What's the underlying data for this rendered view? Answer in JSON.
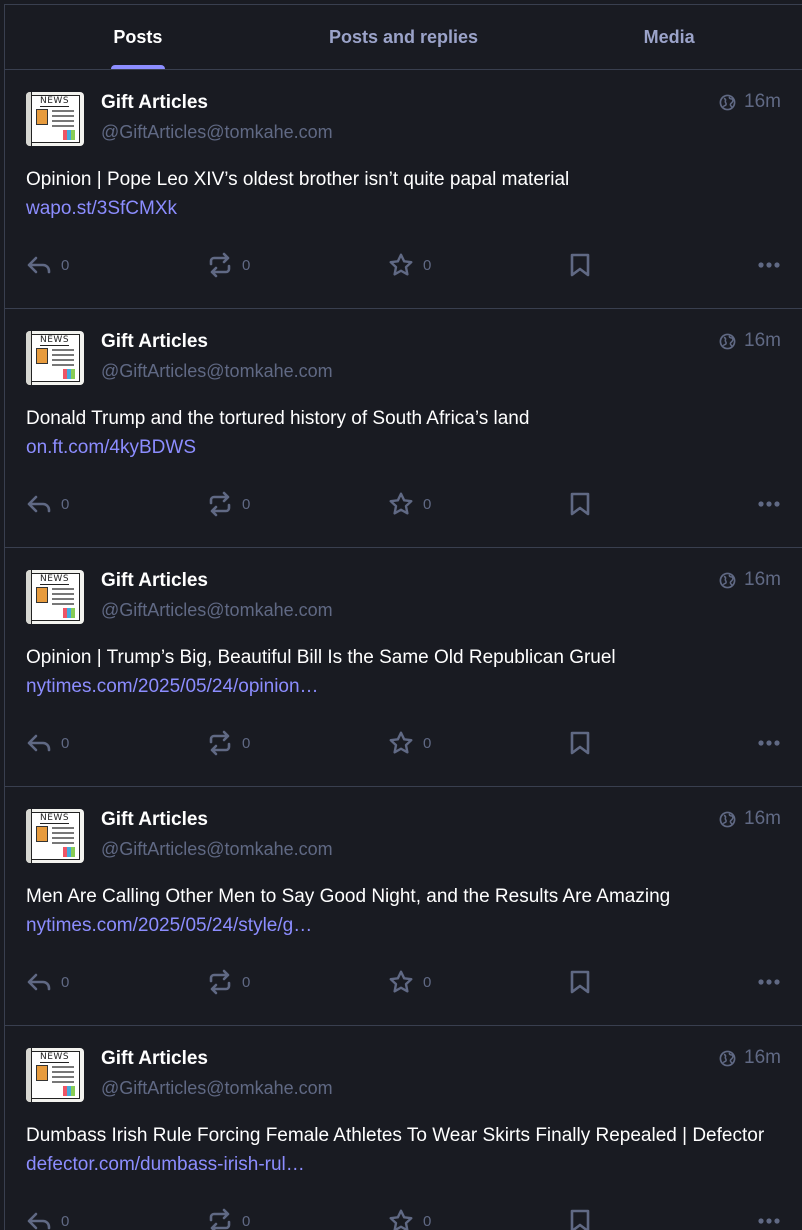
{
  "tabs": [
    {
      "label": "Posts",
      "active": true
    },
    {
      "label": "Posts and replies",
      "active": false
    },
    {
      "label": "Media",
      "active": false
    }
  ],
  "avatar_text": "NEWS",
  "colors": {
    "accent": "#8c8dff",
    "muted": "#606984",
    "bg": "#191b22",
    "border": "#393f4f"
  },
  "posts": [
    {
      "display_name": "Gift Articles",
      "handle": "@GiftArticles@tomkahe.com",
      "time": "16m",
      "visibility_icon": "globe-icon",
      "text": "Opinion | Pope Leo XIV’s oldest brother isn’t quite papal material",
      "link": "wapo.st/3SfCMXk",
      "replies": "0",
      "boosts": "0",
      "favourites": "0"
    },
    {
      "display_name": "Gift Articles",
      "handle": "@GiftArticles@tomkahe.com",
      "time": "16m",
      "visibility_icon": "globe-icon",
      "text": "Donald Trump and the tortured history of South Africa’s land",
      "link": "on.ft.com/4kyBDWS",
      "replies": "0",
      "boosts": "0",
      "favourites": "0"
    },
    {
      "display_name": "Gift Articles",
      "handle": "@GiftArticles@tomkahe.com",
      "time": "16m",
      "visibility_icon": "globe-icon",
      "text": "Opinion | Trump’s Big, Beautiful Bill Is the Same Old Republican Gruel",
      "link": "nytimes.com/2025/05/24/opinion…",
      "replies": "0",
      "boosts": "0",
      "favourites": "0"
    },
    {
      "display_name": "Gift Articles",
      "handle": "@GiftArticles@tomkahe.com",
      "time": "16m",
      "visibility_icon": "globe-icon",
      "text": "Men Are Calling Other Men to Say Good Night, and the Results Are Amazing",
      "link": "nytimes.com/2025/05/24/style/g…",
      "replies": "0",
      "boosts": "0",
      "favourites": "0"
    },
    {
      "display_name": "Gift Articles",
      "handle": "@GiftArticles@tomkahe.com",
      "time": "16m",
      "visibility_icon": "globe-icon",
      "text": "Dumbass Irish Rule Forcing Female Athletes To Wear Skirts Finally Repealed | Defector",
      "link": "defector.com/dumbass-irish-rul…",
      "replies": "0",
      "boosts": "0",
      "favourites": "0"
    }
  ]
}
